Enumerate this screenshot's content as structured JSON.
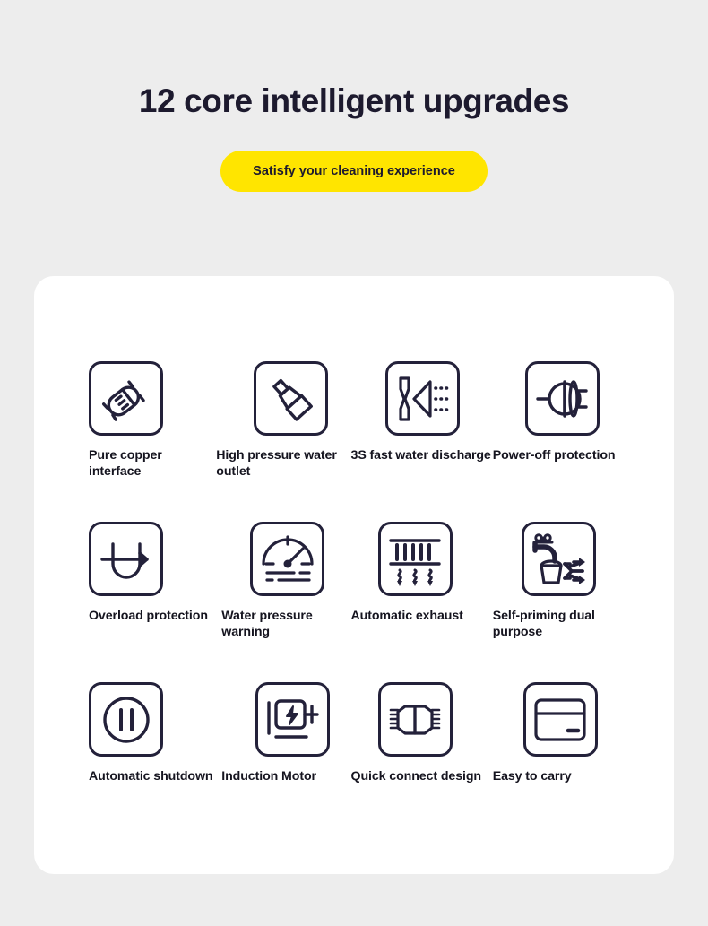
{
  "header": {
    "headline": "12 core intelligent upgrades",
    "subtitle": "Satisfy your cleaning experience"
  },
  "colors": {
    "background": "#ededed",
    "card": "#ffffff",
    "accent_yellow": "#ffe500",
    "ink": "#1d1a2e",
    "icon_stroke": "#23213a"
  },
  "features": [
    {
      "id": "pure-copper-interface",
      "label": "Pure copper interface",
      "icon": "plug-icon"
    },
    {
      "id": "high-pressure-outlet",
      "label": "High pressure water outlet",
      "icon": "spray-nozzle-icon"
    },
    {
      "id": "fast-water-discharge",
      "label": "3S fast water discharge",
      "icon": "water-spray-icon"
    },
    {
      "id": "power-off-protection",
      "label": "Power-off protection",
      "icon": "power-plug-shield-icon"
    },
    {
      "id": "overload-protection",
      "label": "Overload protection",
      "icon": "overload-loop-icon"
    },
    {
      "id": "water-pressure-warning",
      "label": "Water pressure warning",
      "icon": "pressure-gauge-icon"
    },
    {
      "id": "automatic-exhaust",
      "label": "Automatic exhaust",
      "icon": "exhaust-vent-icon"
    },
    {
      "id": "self-priming-dual",
      "label": "Self-priming dual purpose",
      "icon": "faucet-bucket-icon"
    },
    {
      "id": "automatic-shutdown",
      "label": "Automatic shutdown",
      "icon": "pause-circle-icon"
    },
    {
      "id": "induction-motor",
      "label": "Induction Motor",
      "icon": "motor-bolt-icon"
    },
    {
      "id": "quick-connect-design",
      "label": "Quick connect design",
      "icon": "hex-connector-icon"
    },
    {
      "id": "easy-to-carry",
      "label": "Easy to carry",
      "icon": "handle-card-icon"
    }
  ]
}
